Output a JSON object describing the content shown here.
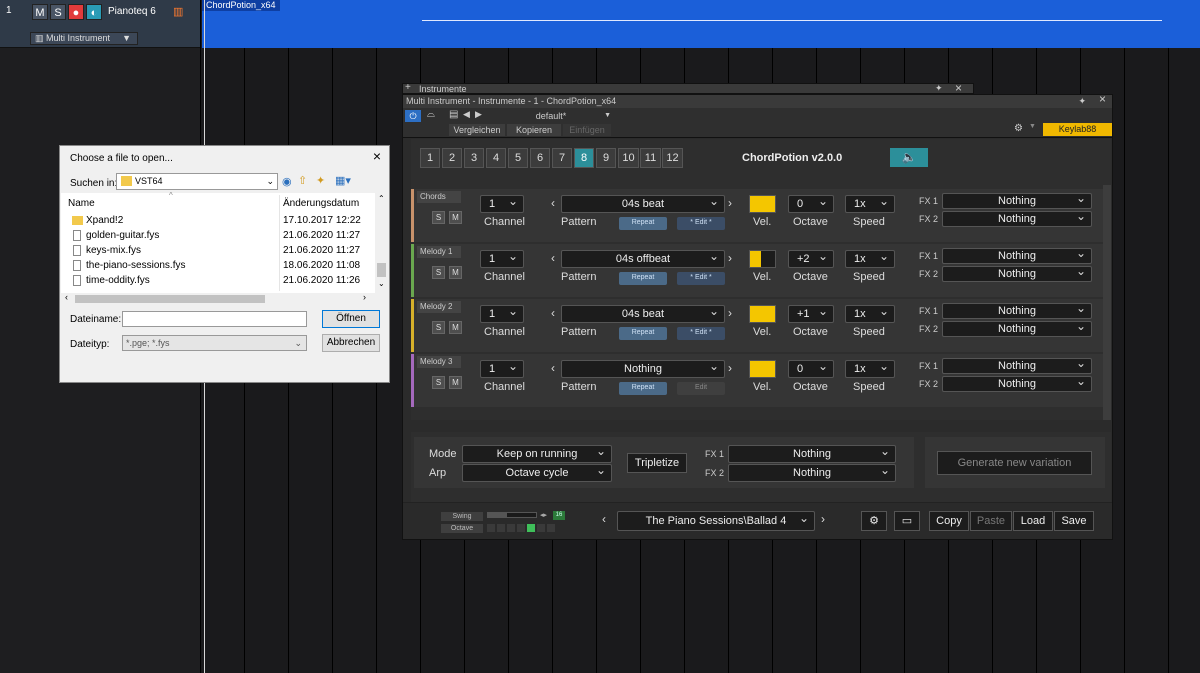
{
  "daw": {
    "track_number": "1",
    "mute": "M",
    "solo": "S",
    "track_name": "Pianoteq 6",
    "instrument": "Multi Instrument",
    "clip_name": "ChordPotion_x64"
  },
  "file_dialog": {
    "title": "Choose a file to open...",
    "look_in_label": "Suchen in:",
    "look_in_value": "VST64",
    "col_name": "Name",
    "col_date": "Änderungsdatum",
    "files": [
      {
        "name": "Xpand!2",
        "date": "17.10.2017 12:22",
        "type": "folder"
      },
      {
        "name": "golden-guitar.fys",
        "date": "21.06.2020 11:27",
        "type": "file"
      },
      {
        "name": "keys-mix.fys",
        "date": "21.06.2020 11:27",
        "type": "file"
      },
      {
        "name": "the-piano-sessions.fys",
        "date": "18.06.2020 11:08",
        "type": "file"
      },
      {
        "name": "time-oddity.fys",
        "date": "21.06.2020 11:26",
        "type": "file"
      }
    ],
    "filename_label": "Dateiname:",
    "filename_value": "",
    "filetype_label": "Dateityp:",
    "filetype_value": "*.pge; *.fys",
    "open_button": "Öffnen",
    "cancel_button": "Abbrechen"
  },
  "plugin": {
    "outer_title": "Instrumente",
    "window_title": "Multi Instrument - Instrumente - 1 - ChordPotion_x64",
    "preset_name": "default*",
    "compare": "Vergleichen",
    "copy": "Kopieren",
    "paste_disabled": "Einfügen",
    "device": "Keylab88",
    "app_title": "ChordPotion v2.0.0",
    "tabs": [
      "1",
      "2",
      "3",
      "4",
      "5",
      "6",
      "7",
      "8",
      "9",
      "10",
      "11",
      "12"
    ],
    "active_tab": 7,
    "labels": {
      "channel": "Channel",
      "pattern": "Pattern",
      "vel": "Vel.",
      "octave": "Octave",
      "speed": "Speed",
      "repeat": "Repeat",
      "edit": "* Edit *",
      "edit_plain": "Edit",
      "s": "S",
      "m": "M",
      "fx1": "FX 1",
      "fx2": "FX 2"
    },
    "lanes": [
      {
        "name": "Chords",
        "channel": "1",
        "pattern": "04s beat",
        "vel": 1.0,
        "octave": "0",
        "speed": "1x",
        "fx1": "Nothing",
        "fx2": "Nothing",
        "edit_active": true,
        "color": "#c8926b"
      },
      {
        "name": "Melody 1",
        "channel": "1",
        "pattern": "04s offbeat",
        "vel": 0.45,
        "octave": "+2",
        "speed": "1x",
        "fx1": "Nothing",
        "fx2": "Nothing",
        "edit_active": true,
        "color": "#6aa84f"
      },
      {
        "name": "Melody 2",
        "channel": "1",
        "pattern": "04s beat",
        "vel": 1.0,
        "octave": "+1",
        "speed": "1x",
        "fx1": "Nothing",
        "fx2": "Nothing",
        "edit_active": true,
        "color": "#d7b12a"
      },
      {
        "name": "Melody 3",
        "channel": "1",
        "pattern": "Nothing",
        "vel": 1.0,
        "octave": "0",
        "speed": "1x",
        "fx1": "Nothing",
        "fx2": "Nothing",
        "edit_active": false,
        "color": "#a569bd"
      }
    ],
    "global": {
      "mode_label": "Mode",
      "mode_value": "Keep on running",
      "arp_label": "Arp",
      "arp_value": "Octave cycle",
      "tripletize": "Tripletize",
      "fx1_label": "FX 1",
      "fx1_value": "Nothing",
      "fx2_label": "FX 2",
      "fx2_value": "Nothing",
      "generate": "Generate new variation"
    },
    "footer": {
      "swing": "Swing",
      "octave": "Octave",
      "swing_value": "16",
      "preset": "The Piano Sessions\\Ballad 4",
      "copy": "Copy",
      "paste": "Paste",
      "load": "Load",
      "save": "Save"
    }
  }
}
